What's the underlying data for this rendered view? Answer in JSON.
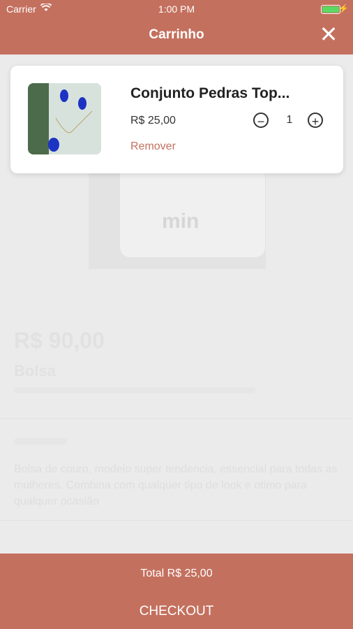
{
  "status_bar": {
    "carrier": "Carrier",
    "time": "1:00 PM"
  },
  "header": {
    "title": "Carrinho",
    "close_icon": "close-icon",
    "color": "#c4705e"
  },
  "cart": {
    "items": [
      {
        "name": "Conjunto Pedras Top...",
        "price": "R$ 25,00",
        "quantity": "1",
        "remove_label": "Remover",
        "image_icon": "jewelry-photo"
      }
    ]
  },
  "background_product": {
    "price": "R$ 90,00",
    "name": "Bolsa",
    "description": "Bolsa de couro, modelo super tendencia, essencial para todas as mulheres. Combina com qualquer tipo de look e otimo para qualquer ocasião",
    "logo_text": "min"
  },
  "footer": {
    "total": "Total R$ 25,00",
    "checkout_label": "CHECKOUT"
  }
}
